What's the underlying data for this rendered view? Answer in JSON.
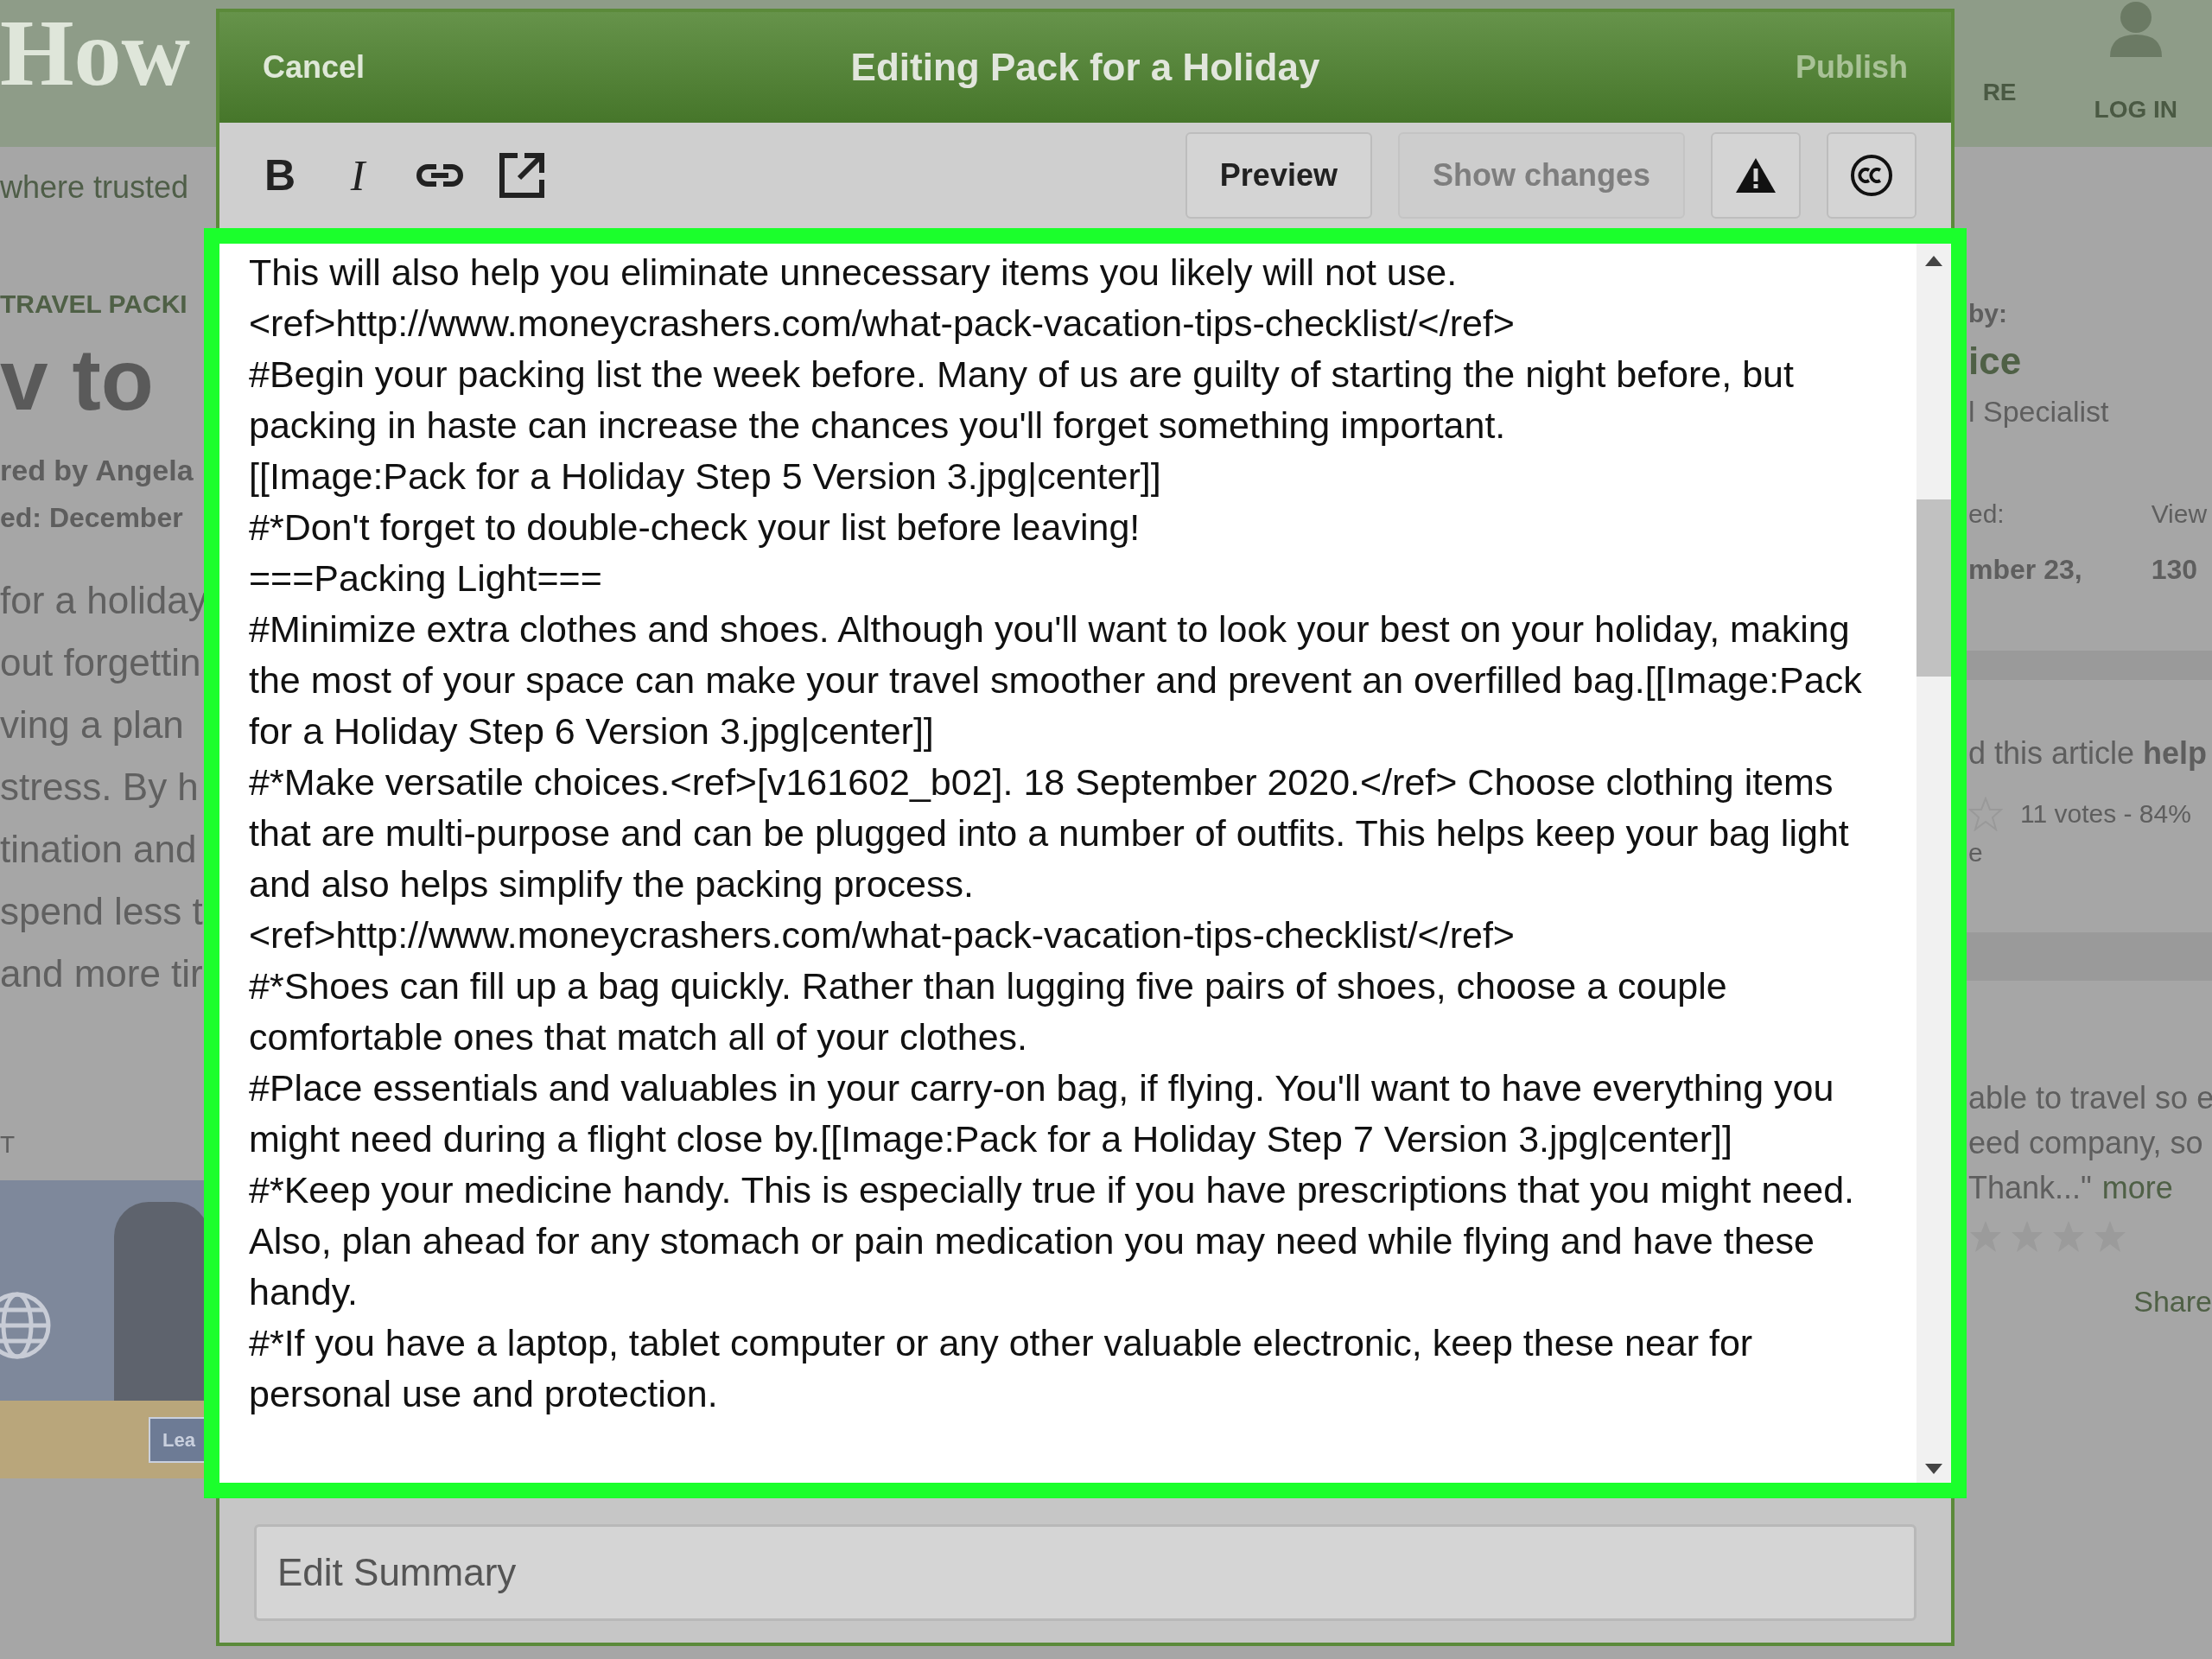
{
  "background_page": {
    "logo": "How",
    "tagline": "where trusted",
    "left": {
      "category": "TRAVEL PACKI",
      "title": "v to",
      "coauthor": "red by Angela",
      "updated": "ed: December",
      "intro_lines": [
        "for a holiday",
        "out forgettin",
        "ving a plan",
        "stress. By h",
        "tination and",
        "spend less t",
        "and more tir"
      ],
      "section_label": "T",
      "ad_button": "Lea"
    },
    "right": {
      "nav_item": "RE",
      "login": "LOG IN",
      "by_label": "by:",
      "author": "ice",
      "role": "l Specialist",
      "updated_label": "ed:",
      "updated_value": "mber 23,",
      "views_label": "View",
      "views_value": "130",
      "helpful_prefix": "d this article ",
      "helpful_bold": "help",
      "votes": "11 votes - 84%",
      "vote_note": "e",
      "review_lines": [
        "able to travel so e",
        "eed company, so",
        "Thank...\""
      ],
      "review_more": "more",
      "share": "Share"
    }
  },
  "editor": {
    "cancel": "Cancel",
    "title": "Editing Pack for a Holiday",
    "publish": "Publish",
    "format_buttons": [
      {
        "kind": "bold",
        "label": "B"
      },
      {
        "kind": "italic",
        "label": "I"
      },
      {
        "kind": "link"
      },
      {
        "kind": "external"
      }
    ],
    "preview": "Preview",
    "show_changes": {
      "label": "Show changes",
      "disabled": true
    },
    "lines": [
      "This will also help you eliminate unnecessary items you likely will not use.",
      "<ref>http://www.moneycrashers.com/what-pack-vacation-tips-checklist/</ref>",
      "#Begin your packing list the week before. Many of us are guilty of starting the night before, but packing in haste can increase the chances you'll forget something important.",
      "[[Image:Pack for a Holiday Step 5 Version 3.jpg|center]]",
      "#*Don't forget to double-check your list before leaving!",
      "===Packing Light===",
      "#Minimize extra clothes and shoes. Although you'll want to look your best on your holiday, making the most of your space can make your travel smoother and prevent an overfilled bag.[[Image:Pack for a Holiday Step 6 Version 3.jpg|center]]",
      "#*Make versatile choices.<ref>[v161602_b02]. 18 September 2020.</ref> Choose clothing items that are multi-purpose and can be plugged into a number of outfits. This helps keep your bag light and also helps simplify the packing process.",
      "<ref>http://www.moneycrashers.com/what-pack-vacation-tips-checklist/</ref>",
      "#*Shoes can fill up a bag quickly. Rather than lugging five pairs of shoes, choose a couple comfortable ones that match all of your clothes.",
      "#Place essentials and valuables in your carry-on bag, if flying. You'll want to have everything you might need during a flight close by.[[Image:Pack for a Holiday Step 7 Version 3.jpg|center]]",
      "#*Keep your medicine handy. This is especially true if you have prescriptions that you might need. Also, plan ahead for any stomach or pain medication you may need while flying and have these handy.",
      "#*If you have a laptop, tablet computer or any other valuable electronic, keep these near for personal use and protection."
    ],
    "summary": {
      "placeholder": "Edit Summary"
    }
  }
}
